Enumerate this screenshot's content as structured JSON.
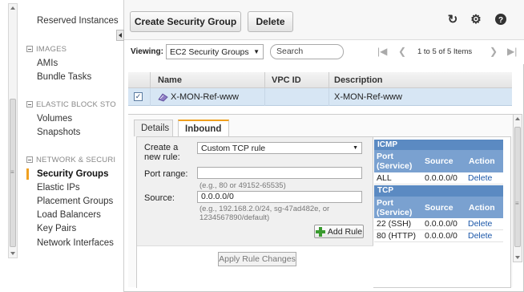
{
  "sidebar": {
    "items_top": [
      {
        "label": "Reserved Instances"
      }
    ],
    "sections": [
      {
        "title": "IMAGES",
        "items": [
          "AMIs",
          "Bundle Tasks"
        ]
      },
      {
        "title": "ELASTIC BLOCK STO",
        "items": [
          "Volumes",
          "Snapshots"
        ]
      },
      {
        "title": "NETWORK & SECURI",
        "items": [
          "Security Groups",
          "Elastic IPs",
          "Placement Groups",
          "Load Balancers",
          "Key Pairs",
          "Network Interfaces"
        ]
      }
    ],
    "active_item": "Security Groups"
  },
  "toolbar": {
    "create_label": "Create Security Group",
    "delete_label": "Delete",
    "icons": [
      "refresh-icon",
      "gear-icon",
      "help-icon"
    ]
  },
  "viewbar": {
    "viewing_label": "Viewing:",
    "viewing_value": "EC2 Security Groups",
    "search_placeholder": "Search",
    "paging_text": "1 to 5 of 5 Items"
  },
  "grid": {
    "columns": [
      "Name",
      "VPC ID",
      "Description"
    ],
    "rows": [
      {
        "name": "X-MON-Ref-www",
        "vpc_id": "",
        "description": "X-MON-Ref-www",
        "selected": true
      }
    ]
  },
  "detail": {
    "tabs": [
      "Details",
      "Inbound"
    ],
    "active_tab": "Inbound",
    "form": {
      "rule_label": "Create a new rule:",
      "rule_value": "Custom TCP rule",
      "port_label": "Port range:",
      "port_value": "",
      "port_help": "(e.g., 80 or 49152-65535)",
      "source_label": "Source:",
      "source_value": "0.0.0.0/0",
      "source_help": "(e.g., 192.168.2.0/24, sg-47ad482e, or 1234567890/default)",
      "add_rule_label": "Add Rule",
      "apply_label": "Apply Rule Changes"
    },
    "rules": {
      "icmp_title": "ICMP",
      "tcp_title": "TCP",
      "headers": {
        "port": "Port (Service)",
        "source": "Source",
        "action": "Action"
      },
      "icmp_rows": [
        {
          "port": "ALL",
          "source": "0.0.0.0/0",
          "action": "Delete"
        }
      ],
      "tcp_rows": [
        {
          "port": "22 (SSH)",
          "source": "0.0.0.0/0",
          "action": "Delete"
        },
        {
          "port": "80 (HTTP)",
          "source": "0.0.0.0/0",
          "action": "Delete"
        }
      ]
    }
  },
  "colors": {
    "accent": "#f0a020",
    "rules_section": "#5b8ac2",
    "rules_header": "#7aa1d0",
    "selected_row": "#d7e6f4",
    "link": "#1a56a8"
  }
}
